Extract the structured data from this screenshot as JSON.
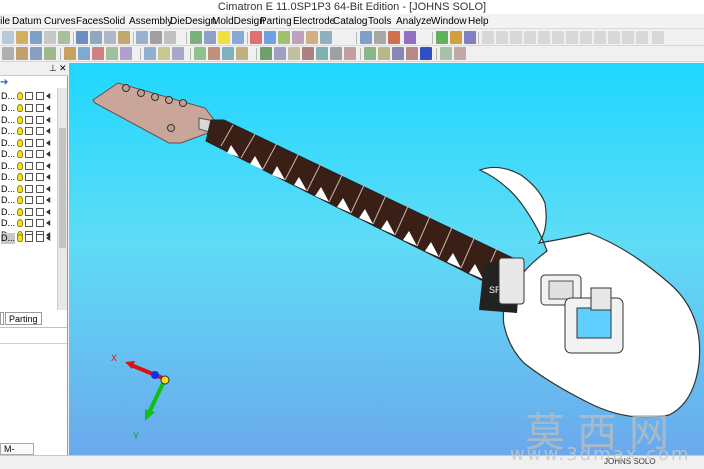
{
  "window": {
    "title": "Cimatron E 11.0SP1P3 64-Bit Edition - [JOHNS SOLO]"
  },
  "menu": [
    "File",
    "Datum",
    "Curves",
    "Faces",
    "Solid",
    "Assembly",
    "DieDesign",
    "MoldDesign",
    "Parting",
    "Electrode",
    "Catalog",
    "Tools",
    "Analyze",
    "Window",
    "Help"
  ],
  "tree": {
    "rows": [
      "D...",
      "D...",
      "D...",
      "D...",
      "D...",
      "D...",
      "D...",
      "D...",
      "D...",
      "D...",
      "D...",
      "D...",
      "D...",
      "D..."
    ],
    "tabs": [
      "Parting"
    ]
  },
  "viewport": {
    "triad": {
      "x_label": "X",
      "y_label": "Y"
    },
    "view_label": "M-View"
  },
  "status": {
    "document": "JOHNS SOLO"
  },
  "watermark": {
    "cn": "莫西网",
    "url": "www.3dmax.com"
  },
  "colors": {
    "viewport_top": "#1fd7ff",
    "viewport_bottom": "#6ba7ec",
    "headstock": "#c9a59a",
    "fretboard": "#3a1f16",
    "body": "#ffffff"
  }
}
